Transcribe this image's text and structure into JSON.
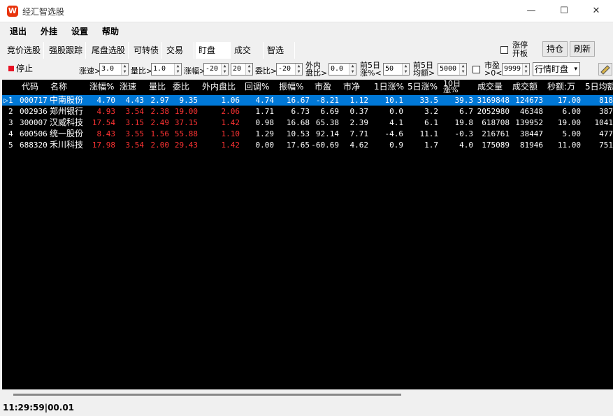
{
  "window": {
    "title": "经汇智选股",
    "icon_letter": "W",
    "controls": {
      "minimize": "—",
      "maximize": "☐",
      "close": "✕"
    }
  },
  "menu": [
    "退出",
    "外挂",
    "设置",
    "帮助"
  ],
  "tabs": [
    "竞价选股",
    "强股跟踪",
    "尾盘选股",
    "可转债",
    "交易",
    "盯盘",
    "成交",
    "智选"
  ],
  "active_tab": "盯盘",
  "right_controls": {
    "limit_open_label": "涨停开板",
    "hold_button": "持仓",
    "refresh_button": "刷新"
  },
  "filters": {
    "stop_button": "停止",
    "speed_label": "涨速>",
    "speed_value": "3.0",
    "volratio_label": "量比>",
    "volratio_value": "1.0",
    "change_label": "涨幅>",
    "change_min": "-20",
    "change_max": "20",
    "bidratio_label": "委比>",
    "bidratio_value": "-20",
    "inout_label": "外内盘比>",
    "inout_value": "0.0",
    "prev5_change_label": "前5日涨%<",
    "prev5_change_value": "50",
    "prev5_amount_label": "前5日均额>",
    "prev5_amount_value": "5000",
    "pe_label": "市盈>0<",
    "pe_value": "9999",
    "mode_select": "行情盯盘"
  },
  "table": {
    "columns": [
      "代码",
      "名称",
      "涨幅%",
      "涨速",
      "量比",
      "委比",
      "外内盘比",
      "回调%",
      "振幅%",
      "市盈",
      "市净",
      "1日涨%",
      "5日涨%",
      "10日涨%",
      "成交量",
      "成交额",
      "秒额:万",
      "5日均额"
    ],
    "rows": [
      {
        "idx": "1",
        "code": "000717",
        "name": "中南股份",
        "chg": "4.70",
        "speed": "4.43",
        "vol": "2.97",
        "bid": "9.35",
        "inout": "1.06",
        "pull": "4.74",
        "amp": "16.67",
        "pe": "-8.21",
        "pb": "1.12",
        "d1": "10.1",
        "d5": "33.5",
        "d10": "39.3",
        "volume": "3169848",
        "amount": "124673",
        "sec": "17.00",
        "avg5": "818"
      },
      {
        "idx": "2",
        "code": "002936",
        "name": "郑州银行",
        "chg": "4.93",
        "speed": "3.54",
        "vol": "2.38",
        "bid": "19.00",
        "inout": "2.06",
        "pull": "1.71",
        "amp": "6.73",
        "pe": "6.69",
        "pb": "0.37",
        "d1": "0.0",
        "d5": "3.2",
        "d10": "6.7",
        "volume": "2052980",
        "amount": "46348",
        "sec": "6.00",
        "avg5": "387"
      },
      {
        "idx": "3",
        "code": "300007",
        "name": "汉威科技",
        "chg": "17.54",
        "speed": "3.15",
        "vol": "2.49",
        "bid": "37.15",
        "inout": "1.42",
        "pull": "0.98",
        "amp": "16.68",
        "pe": "65.38",
        "pb": "2.39",
        "d1": "4.1",
        "d5": "6.1",
        "d10": "19.8",
        "volume": "618708",
        "amount": "139952",
        "sec": "19.00",
        "avg5": "1041"
      },
      {
        "idx": "4",
        "code": "600506",
        "name": "统一股份",
        "chg": "8.43",
        "speed": "3.55",
        "vol": "1.56",
        "bid": "55.88",
        "inout": "1.10",
        "pull": "1.29",
        "amp": "10.53",
        "pe": "92.14",
        "pb": "7.71",
        "d1": "-4.6",
        "d5": "11.1",
        "d10": "-0.3",
        "volume": "216761",
        "amount": "38447",
        "sec": "5.00",
        "avg5": "477"
      },
      {
        "idx": "5",
        "code": "688320",
        "name": "禾川科技",
        "chg": "17.98",
        "speed": "3.54",
        "vol": "2.00",
        "bid": "29.43",
        "inout": "1.42",
        "pull": "0.00",
        "amp": "17.65",
        "pe": "-60.69",
        "pb": "4.62",
        "d1": "0.9",
        "d5": "1.7",
        "d10": "4.0",
        "volume": "175089",
        "amount": "81946",
        "sec": "11.00",
        "avg5": "751"
      }
    ],
    "selected_row": "1"
  },
  "status": {
    "text": "11:29:59|00.01"
  },
  "colors": {
    "grid_bg": "#000000",
    "selection": "#0078d7",
    "up": "#ff3333",
    "text": "#ffffff"
  }
}
